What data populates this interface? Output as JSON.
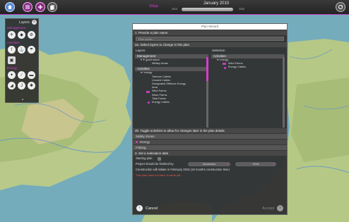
{
  "topbar": {
    "player": "Shipp",
    "date": "January 2010",
    "timeline_start": "2010",
    "timeline_end": "2030",
    "icons": [
      "home-icon",
      "menu-icon",
      "add-icon",
      "list-icon",
      "sync-icon"
    ]
  },
  "layers_panel": {
    "title": "Layers",
    "sections": [
      "Management",
      "Activities",
      "Energy"
    ]
  },
  "wizard": {
    "title": "Plan Wizard",
    "step1": "1. Provide a plan name",
    "name_placeholder": "Plan name...",
    "step2a": "2a. Select layers to change in this plan",
    "layers_label": "Layers",
    "selection_label": "Selection",
    "management_group": "Management",
    "management_items": [
      {
        "label": "governance",
        "kind": "branch"
      },
      {
        "label": "Military Areas",
        "kind": "leaf"
      }
    ],
    "activities_group": "Activities",
    "energy_branch": "energy",
    "energy_items": [
      "Telecom Cables",
      "Unused Cables",
      "Designated Offshore Energy",
      "Area",
      "Wind Farms",
      "Wave Farms",
      "Tidal Farms",
      "Energy Cables"
    ],
    "energy_selected": [
      "Wind Farms",
      "Energy Cables"
    ],
    "selection_group": "Activities",
    "selection_branch": "energy",
    "selection_items": [
      "Wind Farms",
      "Energy Cables"
    ],
    "step2b": "2b. Toggle activities to allow for changes later in the plan details",
    "activity_rows": [
      {
        "label": "Safety Zones",
        "selected": false
      },
      {
        "label": "Energy",
        "selected": true
      },
      {
        "label": "Fishing",
        "selected": false
      }
    ],
    "step3": "3. Set a realisation date",
    "starting_plan": "Starting plan",
    "finished_by": "Project should be finished by",
    "month": "December",
    "year": "2016",
    "construction_note": "Construction will initiate in February 2016  (10 months construction time)",
    "warning": "This plan does not have a name yet.",
    "cancel_label": "Cancel",
    "accept_label": "Accept"
  },
  "colors": {
    "accent": "#d93bcf",
    "home": "#5d8bd5",
    "panel": "#303030",
    "sea": "#6fa6b6",
    "land": "#b9c98a"
  }
}
